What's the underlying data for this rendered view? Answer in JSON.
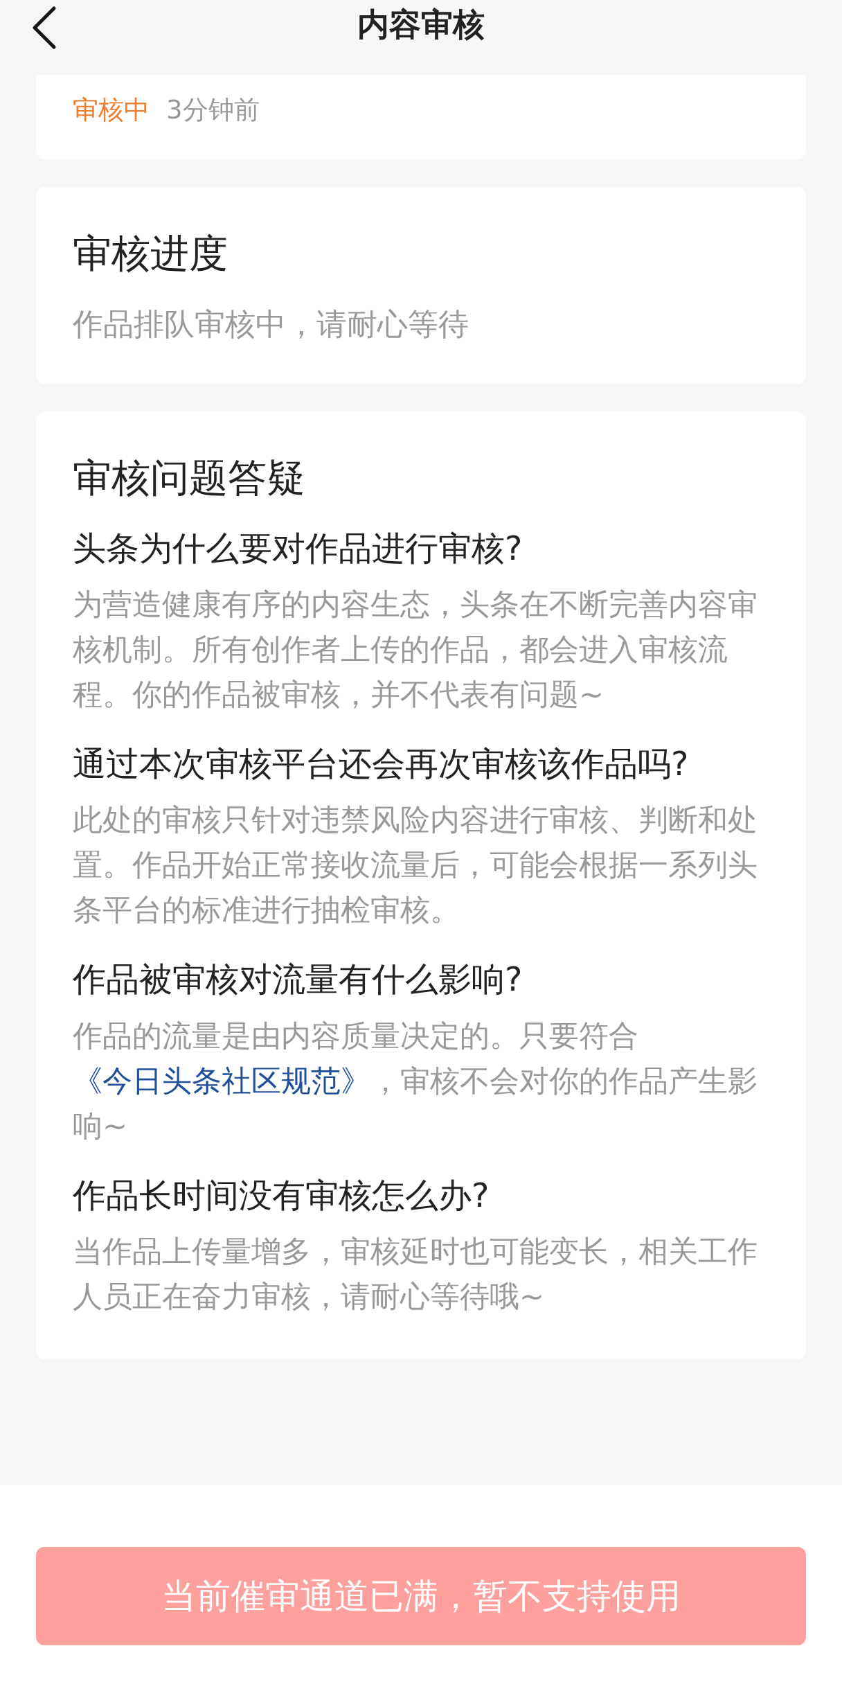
{
  "header": {
    "title": "内容审核"
  },
  "status_card": {
    "status": "审核中",
    "time": "3分钟前"
  },
  "progress_card": {
    "title": "审核进度",
    "description": "作品排队审核中，请耐心等待"
  },
  "faq_card": {
    "title": "审核问题答疑",
    "items": [
      {
        "question": "头条为什么要对作品进行审核?",
        "answer": [
          {
            "kind": "text",
            "text": "为营造健康有序的内容生态，头条在不断完善内容审核机制。所有创作者上传的作品，都会进入审核流程。你的作品被审核，并不代表有问题~"
          }
        ]
      },
      {
        "question": "通过本次审核平台还会再次审核该作品吗?",
        "answer": [
          {
            "kind": "text",
            "text": "此处的审核只针对违禁风险内容进行审核、判断和处置。作品开始正常接收流量后，可能会根据一系列头条平台的标准进行抽检审核。"
          }
        ]
      },
      {
        "question": "作品被审核对流量有什么影响?",
        "answer": [
          {
            "kind": "text",
            "text": "作品的流量是由内容质量决定的。只要符合"
          },
          {
            "kind": "link",
            "text": "《今日头条社区规范》"
          },
          {
            "kind": "text",
            "text": "，审核不会对你的作品产生影响~"
          }
        ]
      },
      {
        "question": "作品长时间没有审核怎么办?",
        "answer": [
          {
            "kind": "text",
            "text": "当作品上传量增多，审核延时也可能变长，相关工作人员正在奋力审核，请耐心等待哦~"
          }
        ]
      }
    ]
  },
  "action_button": {
    "label": "当前催审通道已满，暂不支持使用",
    "disabled": true
  }
}
